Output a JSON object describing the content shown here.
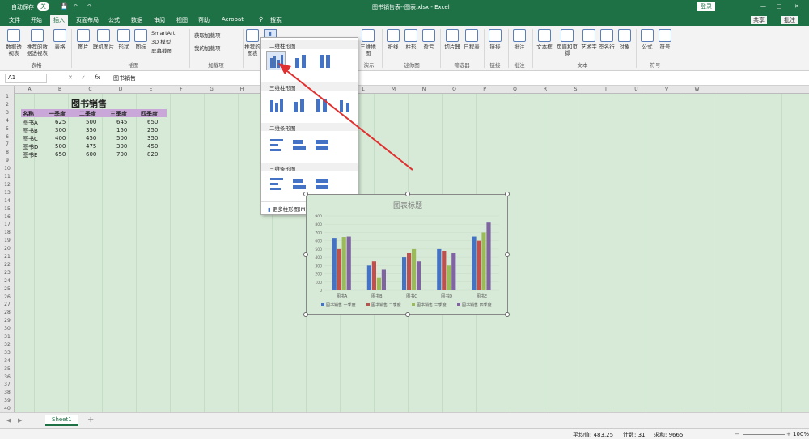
{
  "titlebar": {
    "autosave": "自动保存",
    "autosave_state": "关",
    "filename": "图书销售表--图表.xlsx - Excel",
    "login": "登录"
  },
  "menu": {
    "tabs": [
      "文件",
      "开始",
      "插入",
      "页面布局",
      "公式",
      "数据",
      "审阅",
      "视图",
      "帮助",
      "Acrobat"
    ],
    "active": "插入",
    "search": "搜索",
    "share": "共享",
    "comment": "批注"
  },
  "ribbon": {
    "items": [
      "数据透视表",
      "推荐的数据透视表",
      "表格",
      "图片",
      "联机图片",
      "形状",
      "图标",
      "SmartArt",
      "3D 模型",
      "屏幕截图",
      "获取加载项",
      "我的加载项",
      "推荐的图表",
      "三维地图",
      "折线",
      "柱形",
      "盈亏",
      "切片器",
      "日程表",
      "链接",
      "批注",
      "文本框",
      "页眉和页脚",
      "艺术字",
      "签名行",
      "对象",
      "公式",
      "符号"
    ],
    "groups": [
      "表格",
      "插图",
      "加载项",
      "演示",
      "迷你图",
      "筛选器",
      "链接",
      "批注",
      "文本",
      "符号"
    ]
  },
  "formula": {
    "cell_ref": "A1",
    "fx": "fx",
    "value": "图书销售"
  },
  "columns": [
    "A",
    "B",
    "C",
    "D",
    "E",
    "F",
    "G",
    "H",
    "I",
    "J",
    "K",
    "L",
    "M",
    "N",
    "O",
    "P",
    "Q",
    "R",
    "S",
    "T",
    "U",
    "V",
    "W"
  ],
  "rows": [
    "1",
    "2",
    "3",
    "4",
    "5",
    "6",
    "7",
    "8",
    "9",
    "10",
    "11",
    "12",
    "13",
    "14",
    "15",
    "16",
    "17",
    "18",
    "19",
    "20",
    "21",
    "22",
    "23",
    "24",
    "25",
    "26",
    "27",
    "28",
    "29",
    "30",
    "31",
    "32",
    "33",
    "34",
    "35",
    "36",
    "37",
    "38",
    "39",
    "40"
  ],
  "sheet": {
    "title": "图书销售",
    "headers": [
      "名称",
      "一季度",
      "二季度",
      "三季度",
      "四季度"
    ],
    "data": [
      [
        "图书A",
        "625",
        "500",
        "645",
        "650"
      ],
      [
        "图书B",
        "300",
        "350",
        "150",
        "250"
      ],
      [
        "图书C",
        "400",
        "450",
        "500",
        "350"
      ],
      [
        "图书D",
        "500",
        "475",
        "300",
        "450"
      ],
      [
        "图书E",
        "650",
        "600",
        "700",
        "820"
      ]
    ]
  },
  "dropdown": {
    "sections": [
      "二维柱形图",
      "三维柱形图",
      "二维条形图",
      "三维条形图"
    ],
    "more": "更多柱形图(M)..."
  },
  "chart_data": {
    "type": "bar",
    "title": "图表标题",
    "categories": [
      "图书A",
      "图书B",
      "图书C",
      "图书D",
      "图书E"
    ],
    "series": [
      {
        "name": "图书销售 一季度",
        "values": [
          625,
          300,
          400,
          500,
          650
        ]
      },
      {
        "name": "图书销售 二季度",
        "values": [
          500,
          350,
          450,
          475,
          600
        ]
      },
      {
        "name": "图书销售 三季度",
        "values": [
          645,
          150,
          500,
          300,
          700
        ]
      },
      {
        "name": "图书销售 四季度",
        "values": [
          650,
          250,
          350,
          450,
          820
        ]
      }
    ],
    "colors": [
      "#4472c4",
      "#c0504d",
      "#9bbb59",
      "#8064a2"
    ],
    "ylim": [
      0,
      900
    ],
    "yticks": [
      "0",
      "100",
      "200",
      "300",
      "400",
      "500",
      "600",
      "700",
      "800",
      "900"
    ],
    "legend": "bottom"
  },
  "sheet_tabs": {
    "name": "Sheet1",
    "add": "+"
  },
  "status": {
    "avg": "平均值: 483.25",
    "count": "计数: 31",
    "sum": "求和: 9665",
    "zoom": "100%"
  }
}
